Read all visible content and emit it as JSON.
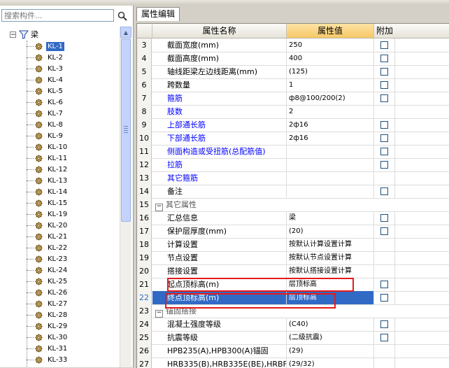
{
  "left_panel": {
    "search_placeholder": "搜索构件...",
    "root_label": "梁",
    "items": [
      {
        "label": "KL-1",
        "selected": true
      },
      {
        "label": "KL-2"
      },
      {
        "label": "KL-3"
      },
      {
        "label": "KL-4"
      },
      {
        "label": "KL-5"
      },
      {
        "label": "KL-6"
      },
      {
        "label": "KL-7"
      },
      {
        "label": "KL-8"
      },
      {
        "label": "KL-9"
      },
      {
        "label": "KL-10"
      },
      {
        "label": "KL-11"
      },
      {
        "label": "KL-12"
      },
      {
        "label": "KL-13"
      },
      {
        "label": "KL-14"
      },
      {
        "label": "KL-15"
      },
      {
        "label": "KL-19"
      },
      {
        "label": "KL-20"
      },
      {
        "label": "KL-21"
      },
      {
        "label": "KL-22"
      },
      {
        "label": "KL-23"
      },
      {
        "label": "KL-24"
      },
      {
        "label": "KL-25"
      },
      {
        "label": "KL-26"
      },
      {
        "label": "KL-27"
      },
      {
        "label": "KL-28"
      },
      {
        "label": "KL-29"
      },
      {
        "label": "KL-30"
      },
      {
        "label": "KL-31"
      },
      {
        "label": "KL-33"
      }
    ]
  },
  "property_panel": {
    "tab_label": "属性编辑",
    "headers": {
      "index": "",
      "name": "属性名称",
      "value": "属性值",
      "add": "附加"
    },
    "rows": [
      {
        "idx": "3",
        "name": "截面宽度(mm)",
        "value": "250",
        "check": true
      },
      {
        "idx": "4",
        "name": "截面高度(mm)",
        "value": "400",
        "check": true
      },
      {
        "idx": "5",
        "name": "轴线距梁左边线距离(mm)",
        "value": "(125)",
        "check": true
      },
      {
        "idx": "6",
        "name": "跨数量",
        "value": "1",
        "check": true
      },
      {
        "idx": "7",
        "name": "箍筋",
        "value": "ф8@100/200(2)",
        "check": true,
        "style": "blue"
      },
      {
        "idx": "8",
        "name": "肢数",
        "value": "2",
        "check": false,
        "style": "blue"
      },
      {
        "idx": "9",
        "name": "上部通长筋",
        "value": "2ф16",
        "check": true,
        "style": "blue"
      },
      {
        "idx": "10",
        "name": "下部通长筋",
        "value": "2ф16",
        "check": true,
        "style": "blue"
      },
      {
        "idx": "11",
        "name": "侧面构造或受扭筋(总配筋值)",
        "value": "",
        "check": true,
        "style": "blue"
      },
      {
        "idx": "12",
        "name": "拉筋",
        "value": "",
        "check": true,
        "style": "blue"
      },
      {
        "idx": "13",
        "name": "其它箍筋",
        "value": "",
        "check": false,
        "style": "blue"
      },
      {
        "idx": "14",
        "name": "备注",
        "value": "",
        "check": true
      },
      {
        "idx": "15",
        "name": "其它属性",
        "value": "",
        "check": false,
        "group": true,
        "expander": "−"
      },
      {
        "idx": "16",
        "name": "汇总信息",
        "value": "梁",
        "check": true
      },
      {
        "idx": "17",
        "name": "保护层厚度(mm)",
        "value": "(20)",
        "check": true
      },
      {
        "idx": "18",
        "name": "计算设置",
        "value": "按默认计算设置计算",
        "check": false
      },
      {
        "idx": "19",
        "name": "节点设置",
        "value": "按默认节点设置计算",
        "check": false
      },
      {
        "idx": "20",
        "name": "搭接设置",
        "value": "按默认搭接设置计算",
        "check": false
      },
      {
        "idx": "21",
        "name": "起点顶标高(m)",
        "value": "层顶标高",
        "check": true
      },
      {
        "idx": "22",
        "name": "终点顶标高(m)",
        "value": "层顶标高",
        "check": true,
        "selected": true
      },
      {
        "idx": "23",
        "name": "锚固搭接",
        "value": "",
        "check": false,
        "group": true,
        "expander": "−"
      },
      {
        "idx": "24",
        "name": "混凝土强度等级",
        "value": "(C40)",
        "check": true
      },
      {
        "idx": "25",
        "name": "抗震等级",
        "value": "(二级抗震)",
        "check": true
      },
      {
        "idx": "26",
        "name": "HPB235(A),HPB300(A)锚固",
        "value": "(29)",
        "check": false
      },
      {
        "idx": "27",
        "name": "HRB335(B),HRB335E(BE),HRBF",
        "value": "(29/32)",
        "check": false
      }
    ]
  }
}
